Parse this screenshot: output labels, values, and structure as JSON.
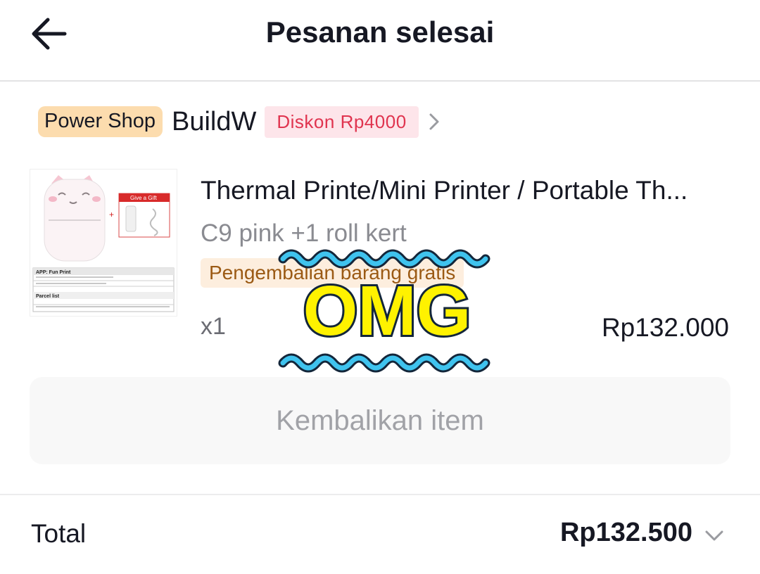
{
  "header": {
    "title": "Pesanan selesai"
  },
  "shop": {
    "badge": "Power Shop",
    "name": "BuildW",
    "discount": "Diskon Rp4000"
  },
  "product": {
    "name": "Thermal Printe/Mini Printer / Portable Th...",
    "variant": "C9 pink +1 roll kert",
    "refund_tag": "Pengembalian barang gratis",
    "quantity": "x1",
    "price": "Rp132.000",
    "image": {
      "gift": "Give a Gift",
      "app": "APP:  Fun Print",
      "parcel": "Parcel list"
    }
  },
  "actions": {
    "return_label": "Kembalikan item"
  },
  "summary": {
    "total_label": "Total",
    "total_value": "Rp132.500"
  },
  "sticker": {
    "text": "OMG"
  },
  "colors": {
    "discount": "#e0344f",
    "power_badge": "#fcdcae",
    "sticker_fill": "#fff200",
    "wave": "#3fc3ee"
  }
}
